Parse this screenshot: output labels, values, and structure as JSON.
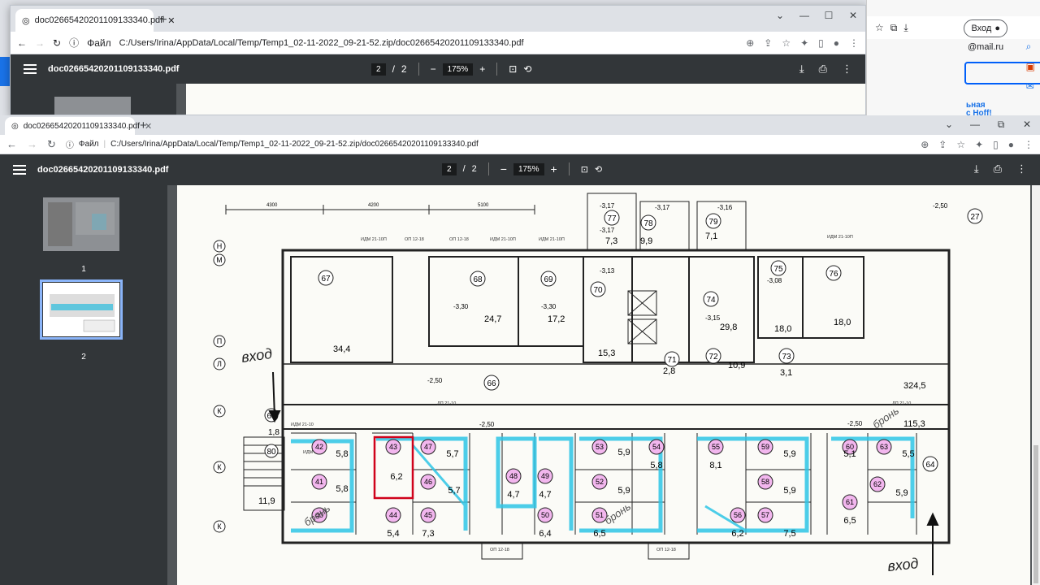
{
  "back_window": {
    "tab_title": "doc02665420201109133340.pdf",
    "url_prefix": "Файл",
    "url": "C:/Users/Irina/AppData/Local/Temp/Temp1_02-11-2022_09-21-52.zip/doc02665420201109133340.pdf",
    "doc_name": "doc02665420201109133340.pdf",
    "page_current": "2",
    "page_sep": "/",
    "page_total": "2",
    "zoom": "175%"
  },
  "right_strip": {
    "login_label": "Вход",
    "mail_suffix": "@mail.ru",
    "promo_line1": "ьная",
    "promo_line2": "с Hoff!"
  },
  "front_window": {
    "tab_title": "doc02665420201109133340.pdf",
    "url_prefix": "Файл",
    "url": "C:/Users/Irina/AppData/Local/Temp/Temp1_02-11-2022_09-21-52.zip/doc02665420201109133340.pdf",
    "doc_name": "doc02665420201109133340.pdf",
    "page_current": "2",
    "page_sep": "/",
    "page_total": "2",
    "zoom": "175%",
    "thumbnails": [
      {
        "label": "1"
      },
      {
        "label": "2"
      }
    ]
  },
  "plan": {
    "dims": [
      "4300",
      "4200",
      "5100"
    ],
    "axis_labels": [
      "Н",
      "М",
      "П",
      "Л",
      "К",
      "К",
      "К"
    ],
    "rooms": {
      "r27": "27",
      "r67": "67",
      "r68": "68",
      "r69": "69",
      "r70": "70",
      "r71": "71",
      "r72": "72",
      "r73": "73",
      "r74": "74",
      "r75": "75",
      "r76": "76",
      "r77": "77",
      "r78": "78",
      "r79": "79",
      "r66": "66",
      "r65": "65",
      "r64": "64",
      "r80": "80"
    },
    "areas": {
      "a67": "34,4",
      "a68": "24,7",
      "a69": "17,2",
      "a70": "15,3",
      "a71": "2,8",
      "a72": "10,9",
      "a73": "3,1",
      "a74": "29,8",
      "a75": "18,0",
      "a76": "18,0",
      "a77": "7,3",
      "a78": "9,9",
      "a79": "7,1",
      "a64": "324,5",
      "a64b": "115,3",
      "a65": "1,8",
      "a80": "11,9"
    },
    "levels": [
      "-3,30",
      "-3,30",
      "-3,15",
      "-2,50",
      "-2,50",
      "-2,50",
      "-2,50",
      "-3,17",
      "-3,17",
      "-3,16",
      "-3,17",
      "-3,08",
      "-3,13"
    ],
    "handwritten": [
      "вход",
      "вход",
      "бронь",
      "бронь",
      "бронь"
    ],
    "small_rooms": [
      {
        "n": "42",
        "a": "5,8"
      },
      {
        "n": "41",
        "a": "5,8"
      },
      {
        "n": "40",
        "a": ""
      },
      {
        "n": "43",
        "a": "6,2"
      },
      {
        "n": "44",
        "a": "5,4"
      },
      {
        "n": "47",
        "a": "5,7"
      },
      {
        "n": "46",
        "a": "5,7"
      },
      {
        "n": "45",
        "a": "7,3"
      },
      {
        "n": "48",
        "a": "4,7"
      },
      {
        "n": "49",
        "a": "4,7"
      },
      {
        "n": "50",
        "a": "6,4"
      },
      {
        "n": "53",
        "a": "5,9"
      },
      {
        "n": "54",
        "a": "5,8"
      },
      {
        "n": "52",
        "a": "5,9"
      },
      {
        "n": "51",
        "a": "6,5"
      },
      {
        "n": "55",
        "a": "8,1"
      },
      {
        "n": "56",
        "a": "6,2"
      },
      {
        "n": "59",
        "a": "5,9"
      },
      {
        "n": "58",
        "a": "5,9"
      },
      {
        "n": "57",
        "a": "7,5"
      },
      {
        "n": "60",
        "a": "5,1"
      },
      {
        "n": "61",
        "a": "6,5"
      },
      {
        "n": "63",
        "a": "5,5"
      },
      {
        "n": "62",
        "a": "5,9"
      }
    ],
    "marks": [
      "ИДМ 21-10П",
      "ОП 12-18",
      "ОП 12-18",
      "ИДМ 21-10П",
      "ИДМ 21-10П",
      "ИДМ 21-10П",
      "ДП 21-10",
      "ИДМ 21-10",
      "ИДМ 21-9",
      "ОП 12-18",
      "ОП 12-18",
      "ДП 21-10"
    ]
  }
}
